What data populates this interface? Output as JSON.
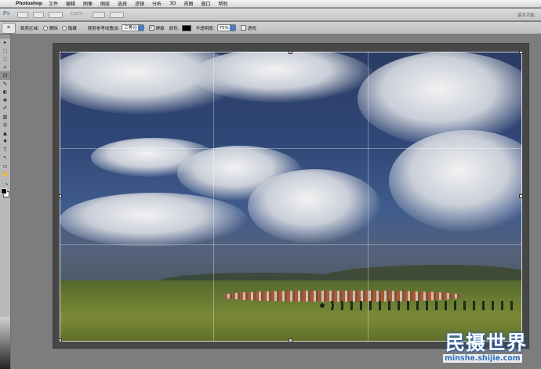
{
  "menubar": {
    "apple": "",
    "app_name": "Photoshop",
    "items": [
      "文件",
      "编辑",
      "图像",
      "图层",
      "选择",
      "滤镜",
      "分析",
      "3D",
      "视图",
      "窗口",
      "帮助"
    ]
  },
  "appbar": {
    "logo": "Ps",
    "zoom": "100%",
    "workspace": "基本功能"
  },
  "options": {
    "tool_icon": "crop-icon",
    "crop_area_label": "裁剪区域:",
    "delete_label": "删除",
    "hide_label": "隐藏",
    "guide_overlay_label": "裁剪参考线叠加:",
    "guide_overlay_value": "三等分",
    "shield_label": "屏蔽",
    "color_label": "颜色:",
    "shield_color": "#000000",
    "opacity_label": "不透明度:",
    "opacity_value": "75%",
    "perspective_label": "透视",
    "cancel_icon": "cancel-icon",
    "commit_icon": "checkmark-icon"
  },
  "tools": [
    "▸",
    "⬚",
    "◌",
    "⌖",
    "⊡",
    "✎",
    "◐",
    "✚",
    "✐",
    "▥",
    "◎",
    "▲",
    "♦",
    "T",
    "↖",
    "▭",
    "✋",
    "🔍"
  ],
  "colors": {
    "accent": "#4d79c8",
    "watermark": "#2e6fc0"
  },
  "watermark": {
    "text": "民摄世界",
    "url": "minshe.shijie.com"
  }
}
